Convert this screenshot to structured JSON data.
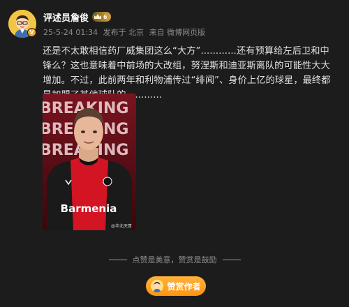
{
  "post": {
    "username": "评述员詹俊",
    "level_badge": "6",
    "vip_mark": "V",
    "meta": {
      "timestamp": "25-5-24 01:34",
      "location": "发布于 北京",
      "source": "来自 微博网页版"
    },
    "text": "还是不太敢相信药厂威集团这么“大方”............还有预算给左后卫和中锋么？这也意味着中前场的大改组，努涅斯和迪亚斯离队的可能性大大增加。不过，此前两年和利物浦传过“绯闻”、身价上亿的球星，最终都是加盟了其他球队的............",
    "photo": {
      "overlay_word": "BREAKING",
      "jersey_text": "Barmenia",
      "watermark": "@华北天青"
    }
  },
  "footer": {
    "like_hint": "点赞是美意，赞赏是鼓励",
    "tip_button": "赞赏作者"
  },
  "colors": {
    "background": "#1c1c1c",
    "accent": "#ff9f1c",
    "muted": "#8c8c8c"
  },
  "icons": [
    "avatar-cartoon",
    "crown-icon",
    "vip-icon"
  ]
}
